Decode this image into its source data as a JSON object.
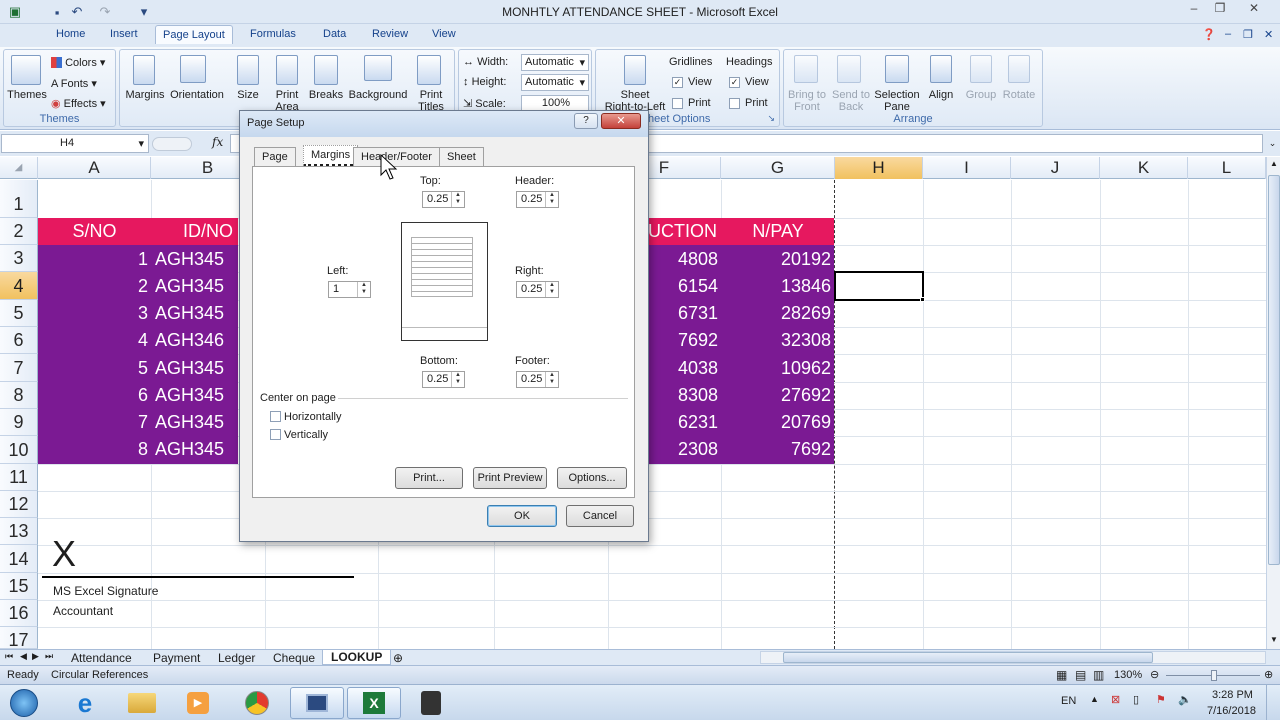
{
  "window": {
    "title": "MONHTLY ATTENDANCE SHEET - Microsoft Excel"
  },
  "tabs": [
    "Home",
    "Insert",
    "Page Layout",
    "Formulas",
    "Data",
    "Review",
    "View"
  ],
  "active_tab": "Page Layout",
  "ribbon": {
    "themes": {
      "themes_label": "Themes",
      "colors": "Colors",
      "fonts": "Fonts",
      "effects": "Effects",
      "group": "Themes"
    },
    "page_setup": {
      "margins": "Margins",
      "orientation": "Orientation",
      "size": "Size",
      "print_area": "Print\nArea",
      "breaks": "Breaks",
      "background": "Background",
      "print_titles": "Print\nTitles"
    },
    "scale": {
      "width_label": "Width:",
      "width_value": "Automatic",
      "height_label": "Height:",
      "height_value": "Automatic",
      "scale_label": "Scale:",
      "scale_value": "100%"
    },
    "sheet_options": {
      "sheet_rtl": "Sheet\nRight-to-Left",
      "gridlines": "Gridlines",
      "headings": "Headings",
      "view": "View",
      "print": "Print",
      "group": "heet Options"
    },
    "arrange": {
      "bring_front": "Bring to\nFront",
      "send_back": "Send to\nBack",
      "selection_pane": "Selection\nPane",
      "align": "Align",
      "group_btn": "Group",
      "rotate": "Rotate",
      "group": "Arrange"
    }
  },
  "name_box": "H4",
  "fx": "fx",
  "columns": [
    "A",
    "B",
    "F",
    "G",
    "H",
    "I",
    "J",
    "K",
    "L"
  ],
  "row_numbers": [
    "1",
    "2",
    "3",
    "4",
    "5",
    "6",
    "7",
    "8",
    "9",
    "10",
    "11",
    "12",
    "13",
    "14",
    "15",
    "16",
    "17"
  ],
  "table": {
    "header": {
      "sno": "S/NO",
      "id": "ID/NO",
      "deduction": "UCTION",
      "npay": "N/PAY"
    },
    "rows": [
      {
        "sno": "1",
        "id": "AGH345",
        "ded": "4808",
        "npay": "20192"
      },
      {
        "sno": "2",
        "id": "AGH345",
        "ded": "6154",
        "npay": "13846"
      },
      {
        "sno": "3",
        "id": "AGH345",
        "ded": "6731",
        "npay": "28269"
      },
      {
        "sno": "4",
        "id": "AGH346",
        "ded": "7692",
        "npay": "32308"
      },
      {
        "sno": "5",
        "id": "AGH345",
        "ded": "4038",
        "npay": "10962"
      },
      {
        "sno": "6",
        "id": "AGH345",
        "ded": "8308",
        "npay": "27692"
      },
      {
        "sno": "7",
        "id": "AGH345",
        "ded": "6231",
        "npay": "20769"
      },
      {
        "sno": "8",
        "id": "AGH345",
        "ded": "2308",
        "npay": "7692"
      }
    ]
  },
  "signature": {
    "mark": "X",
    "line1": "MS Excel Signature",
    "line2": "Accountant"
  },
  "dialog": {
    "title": "Page Setup",
    "help": "?",
    "tabs": [
      "Page",
      "Margins",
      "Header/Footer",
      "Sheet"
    ],
    "active_tab": "Margins",
    "top_label": "Top:",
    "top_value": "0.25",
    "header_label": "Header:",
    "header_value": "0.25",
    "left_label": "Left:",
    "left_value": "1",
    "right_label": "Right:",
    "right_value": "0.25",
    "bottom_label": "Bottom:",
    "bottom_value": "0.25",
    "footer_label": "Footer:",
    "footer_value": "0.25",
    "center_label": "Center on page",
    "horizontally": "Horizontally",
    "vertically": "Vertically",
    "print_btn": "Print...",
    "preview_btn": "Print Preview",
    "options_btn": "Options...",
    "ok": "OK",
    "cancel": "Cancel"
  },
  "sheet_tabs": [
    "Attendance",
    "Payment",
    "Ledger",
    "Cheque",
    "LOOKUP"
  ],
  "active_sheet": "LOOKUP",
  "status": {
    "ready": "Ready",
    "circular": "Circular References",
    "zoom": "130%"
  },
  "taskbar": {
    "lang": "EN",
    "time": "3:28 PM",
    "date": "7/16/2018"
  },
  "colors": {
    "header_pink": "#e6185f",
    "row_purple": "#7b1a93",
    "ribbon_blue": "#dfe9f5"
  }
}
